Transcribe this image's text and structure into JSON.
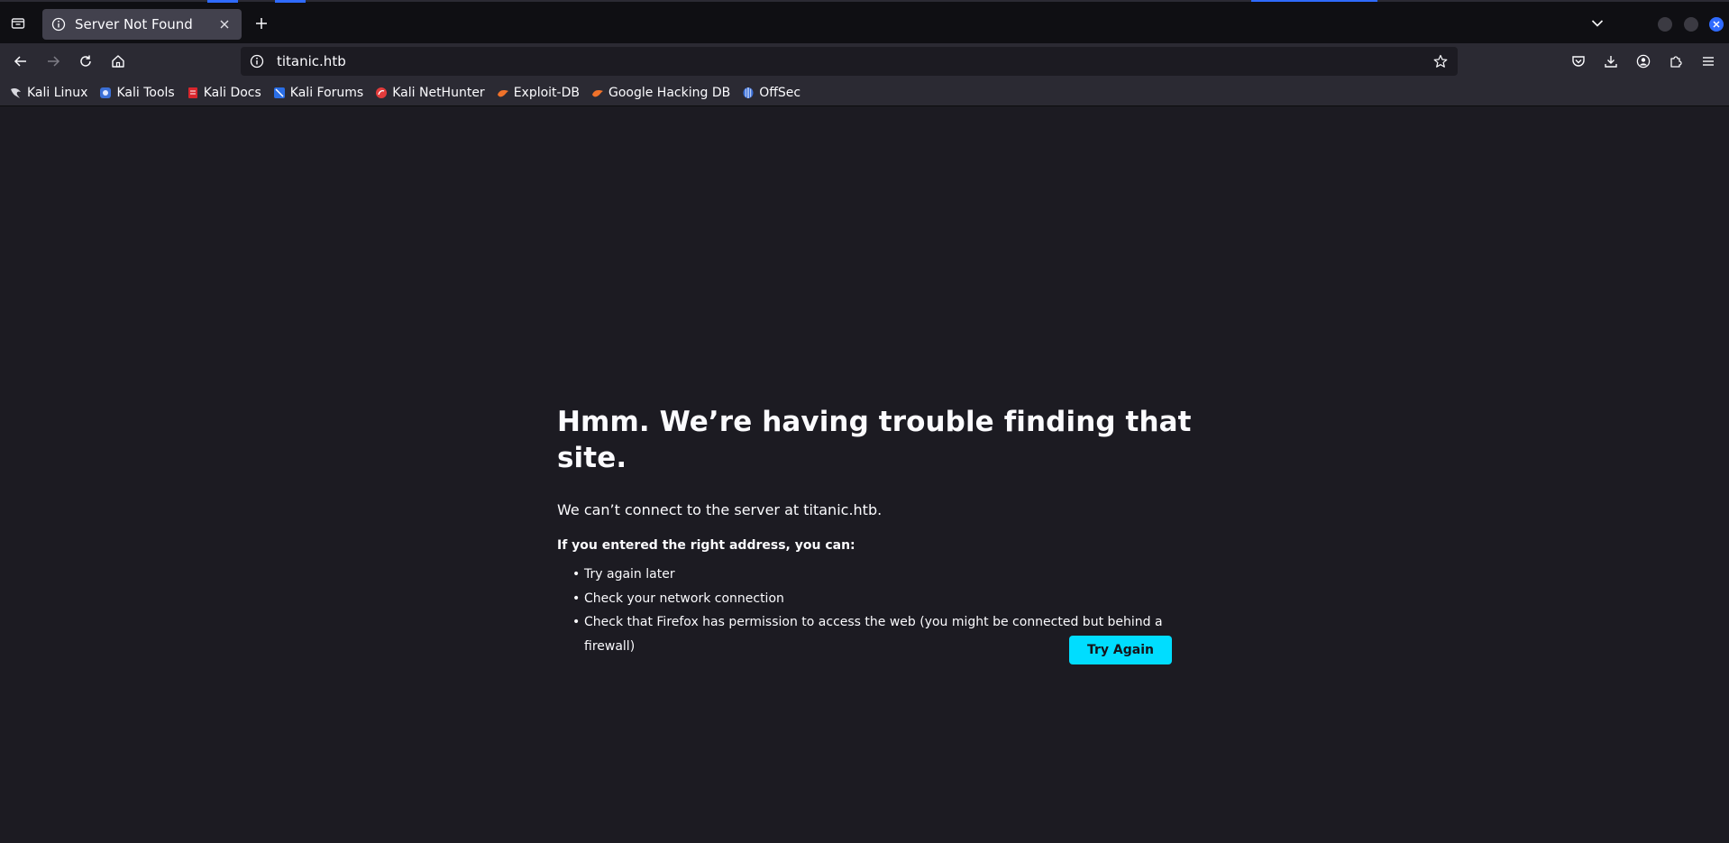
{
  "tab": {
    "title": "Server Not Found",
    "icon": "info-icon"
  },
  "address_bar": {
    "url": "titanic.htb"
  },
  "bookmarks": [
    {
      "label": "Kali Linux",
      "icon": "kali-dragon-icon",
      "color": "#1a1a1a"
    },
    {
      "label": "Kali Tools",
      "icon": "kali-tools-icon",
      "color": "#3b6fd6"
    },
    {
      "label": "Kali Docs",
      "icon": "kali-docs-icon",
      "color": "#d9262d"
    },
    {
      "label": "Kali Forums",
      "icon": "kali-forums-icon",
      "color": "#2a6ee6"
    },
    {
      "label": "Kali NetHunter",
      "icon": "kali-nethunter-icon",
      "color": "#e23b3b"
    },
    {
      "label": "Exploit-DB",
      "icon": "exploit-db-icon",
      "color": "#f0722a"
    },
    {
      "label": "Google Hacking DB",
      "icon": "ghdb-icon",
      "color": "#f0722a"
    },
    {
      "label": "OffSec",
      "icon": "offsec-icon",
      "color": "#3b6fd6"
    }
  ],
  "error_page": {
    "heading": "Hmm. We’re having trouble finding that site.",
    "lead": "We can’t connect to the server at titanic.htb.",
    "advice_title": "If you entered the right address, you can:",
    "suggestions": [
      "Try again later",
      "Check your network connection",
      "Check that Firefox has permission to access the web (you might be connected but behind a firewall)"
    ],
    "button_label": "Try Again"
  },
  "colors": {
    "accent": "#00ddff",
    "page_background": "#1c1b22",
    "toolbar": "#2b2a33"
  }
}
